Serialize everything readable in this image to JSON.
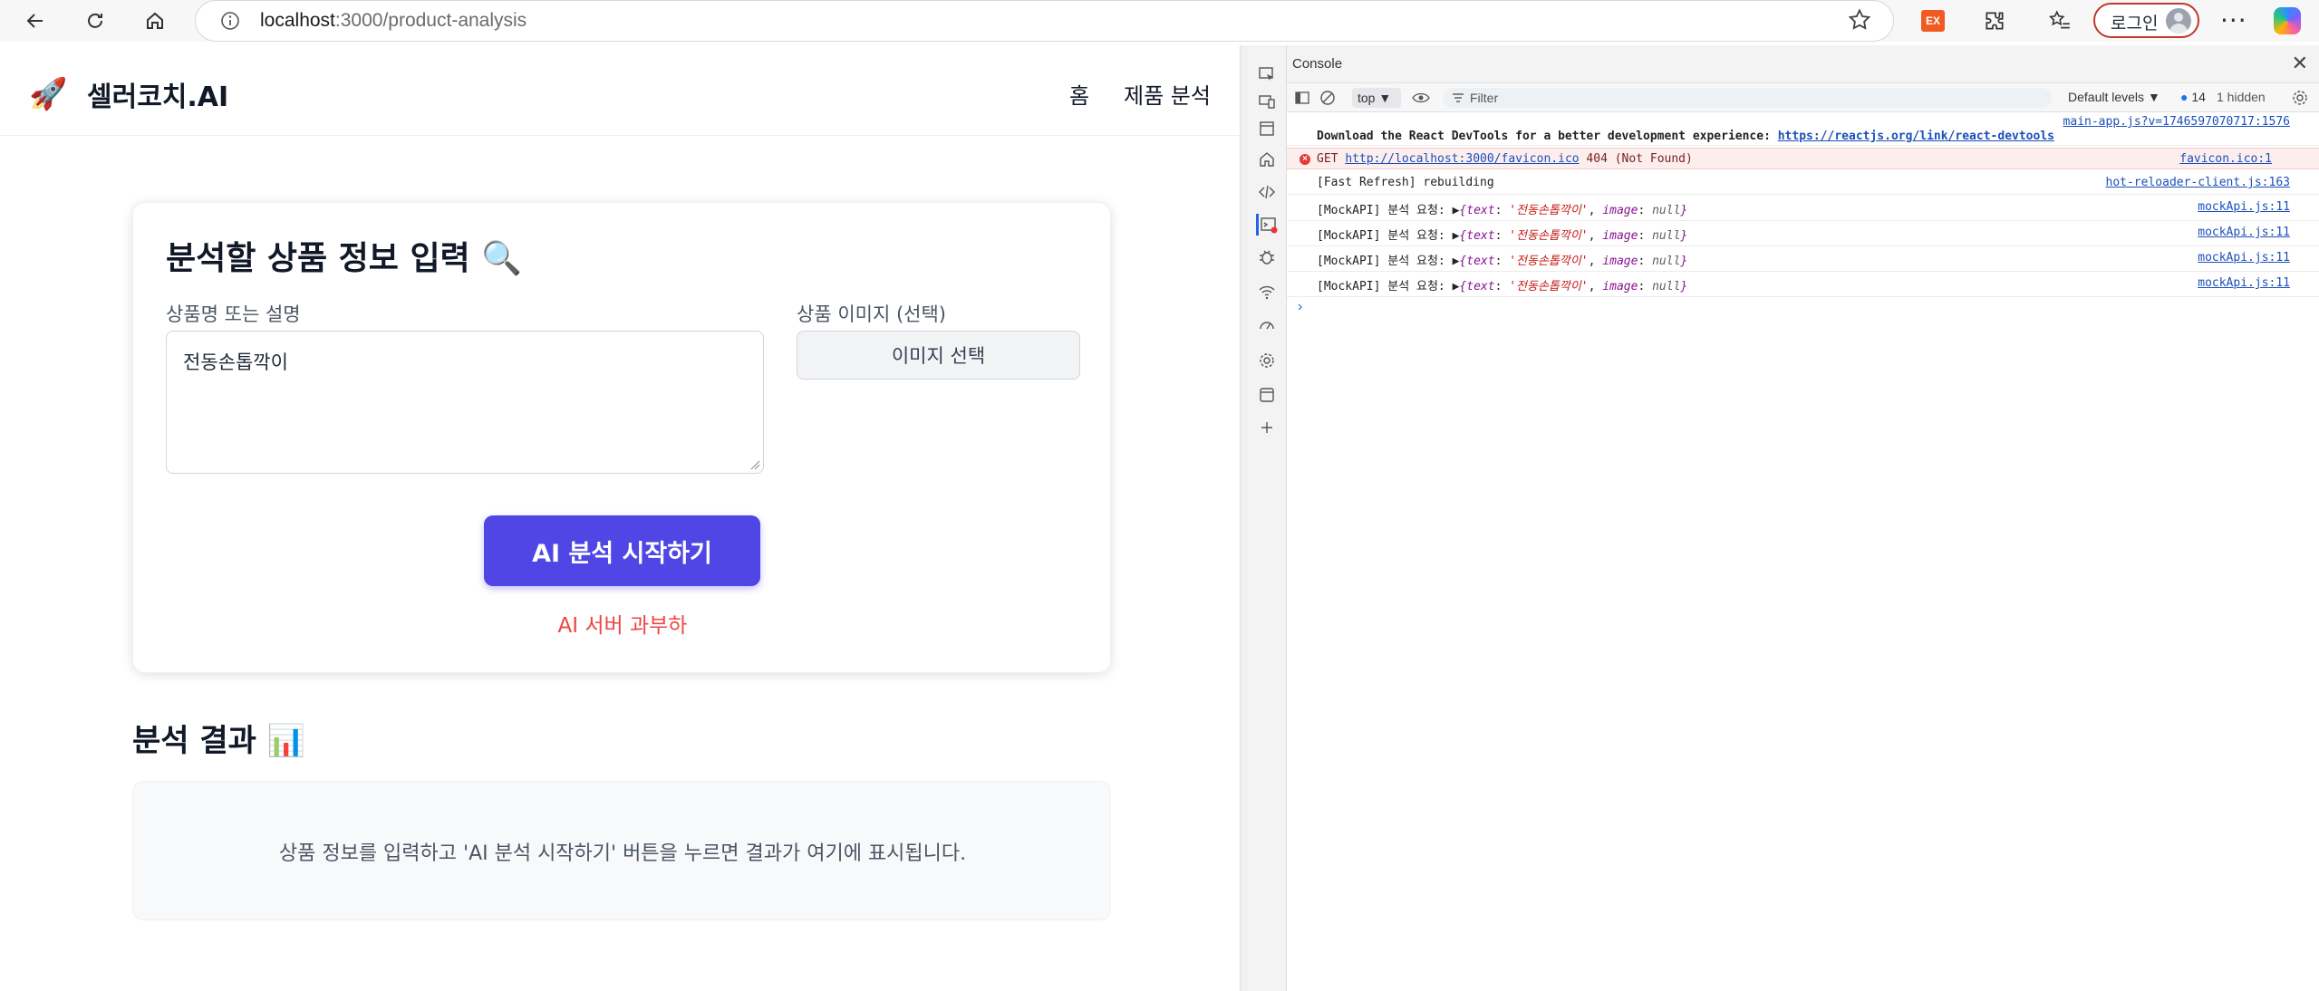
{
  "browser": {
    "url_host": "localhost",
    "url_path": ":3000/product-analysis",
    "ext_label": "EX",
    "login_label": "로그인",
    "more_label": "···"
  },
  "app": {
    "logo_icon": "🚀",
    "brand": "셀러코치.AI",
    "nav": [
      "홈",
      "제품 분석"
    ],
    "form": {
      "title": "분석할 상품 정보 입력",
      "title_icon": "🔍",
      "desc_label": "상품명 또는 설명",
      "desc_value": "전동손톱깍이",
      "image_label": "상품 이미지 (선택)",
      "image_button": "이미지 선택",
      "submit_button": "AI 분석 시작하기",
      "error": "AI 서버 과부하"
    },
    "result": {
      "title": "분석 결과",
      "title_icon": "📊",
      "placeholder": "상품 정보를 입력하고 'AI 분석 시작하기' 버튼을 누르면 결과가 여기에 표시됩니다."
    }
  },
  "devtools": {
    "panel_title": "Console",
    "context": "top",
    "filter_placeholder": "Filter",
    "levels": "Default levels",
    "issues_count": "14",
    "hidden": "1 hidden",
    "logs": [
      {
        "msg": "",
        "src": "main-app.js?v=1746597070717:1576"
      },
      {
        "msg": "Download the React DevTools for a better development experience: ",
        "link": "https://reactjs.org/link/react-devtools",
        "src": ""
      },
      {
        "method": "GET",
        "url": "http://localhost:3000/favicon.ico",
        "status": "404 (Not Found)",
        "src": "favicon.ico:1"
      },
      {
        "msg": "[Fast Refresh] rebuilding",
        "src": "hot-reloader-client.js:163"
      },
      {
        "msg": "[MockAPI] 분석 요청:",
        "src": "mockApi.js:11"
      },
      {
        "msg": "[MockAPI] 분석 요청:",
        "src": "mockApi.js:11"
      },
      {
        "msg": "[MockAPI] 분석 요청:",
        "src": "mockApi.js:11"
      },
      {
        "msg": "[MockAPI] 분석 요청:",
        "src": "mockApi.js:11"
      }
    ],
    "obj": {
      "open": "{",
      "k1": "text",
      "v1": "'전동손톱깍이'",
      "k2": "image",
      "v2": "null",
      "close": "}"
    },
    "prompt": "›"
  }
}
